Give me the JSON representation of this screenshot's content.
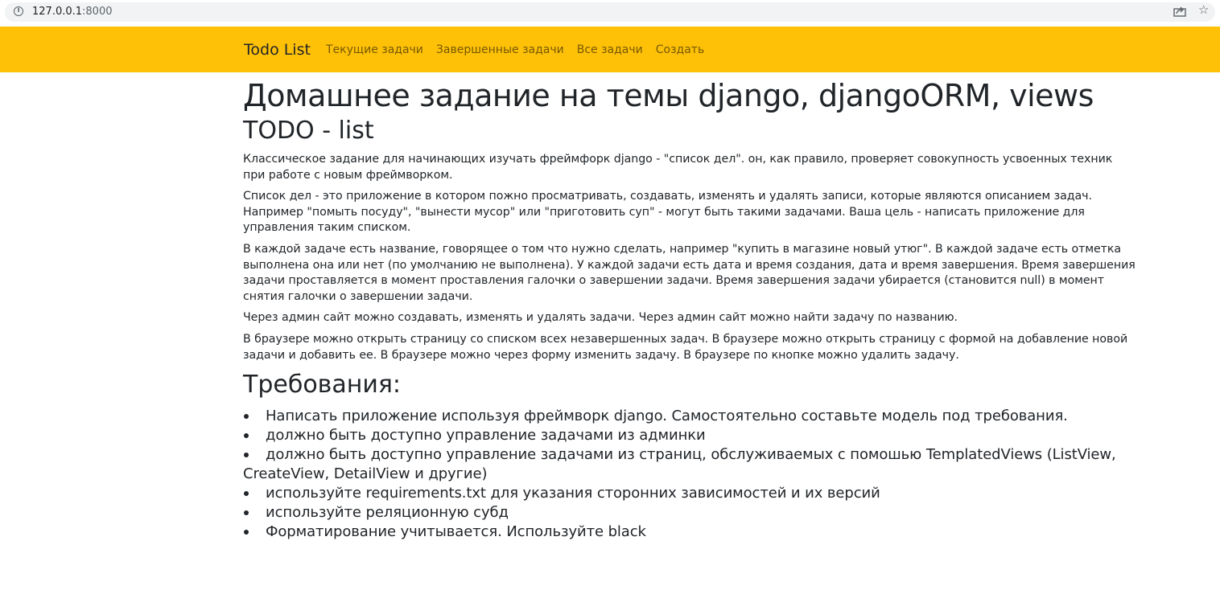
{
  "browser": {
    "url_host": "127.0.0.1",
    "url_port": ":8000"
  },
  "navbar": {
    "brand": "Todo List",
    "links": [
      "Текущие задачи",
      "Завершенные задачи",
      "Все задачи",
      "Создать"
    ],
    "color": "#ffc107"
  },
  "main": {
    "title": "Домашнее задание на темы django, djangoORM, views",
    "subtitle": "TODO - list",
    "paragraphs": [
      "Классическое задание для начинающих изучать фреймфорк django - \"список дел\". он, как правило, проверяет совокупность усвоенных техник при работе с новым фреймворком.",
      "Список дел - это приложение в котором пожно просматривать, создавать, изменять и удалять записи, которые являются описанием задач. Например \"помыть посуду\", \"вынести мусор\" или \"приготовить суп\" - могут быть такими задачами. Ваша цель - написать приложение для управления таким списком.",
      "В каждой задаче есть название, говорящее о том что нужно сделать, например \"купить в магазине новый утюг\". В каждой задаче есть отметка выполнена она или нет (по умолчанию не выполнена). У каждой задачи есть дата и время создания, дата и время завершения. Время завершения задачи проставляется в момент проставления галочки о завершении задачи. Время завершения задачи убирается (становится null) в момент снятия галочки о завершении задачи.",
      "Через админ сайт можно создавать, изменять и удалять задачи. Через админ сайт можно найти задачу по названию.",
      "В браузере можно открыть страницу со списком всех незавершенных задач. В браузере можно открыть страницу с формой на добавление новой задачи и добавить ее. В браузере можно через форму изменить задачу. В браузере по кнопке можно удалить задачу."
    ],
    "requirements_title": "Требования:",
    "requirements": [
      "Написать приложение используя фреймворк django. Самостоятельно составьте модель под требования.",
      "должно быть доступно управление задачами из админки",
      "должно быть доступно управление задачами из страниц, обслуживаемых с помошью TemplatedViews (ListView, CreateView, DetailView и другие)",
      "используйте requirements.txt для указания сторонних зависимостей и их версий",
      "используйте реляционную субд",
      "Форматирование учитывается. Используйте black"
    ]
  }
}
